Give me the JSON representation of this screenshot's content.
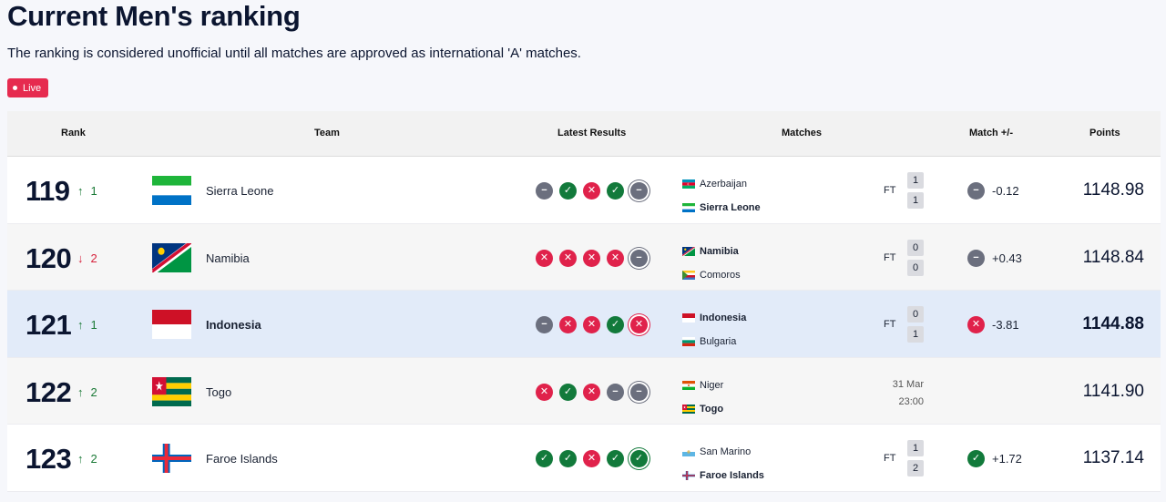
{
  "page": {
    "title": "Current Men's ranking",
    "subtitle": "The ranking is considered unofficial until all matches are approved as international 'A' matches.",
    "live_label": "Live"
  },
  "columns": {
    "rank": "Rank",
    "team": "Team",
    "latest_results": "Latest Results",
    "matches": "Matches",
    "match_pm": "Match +/-",
    "points": "Points"
  },
  "rows": [
    {
      "rank": "119",
      "move_dir": "up",
      "move": "1",
      "team": "Sierra Leone",
      "flag": "sierra-leone",
      "results": [
        "draw",
        "win",
        "loss",
        "win",
        "draw"
      ],
      "home": "Azerbaijan",
      "home_flag": "azerbaijan",
      "away": "Sierra Leone",
      "away_flag": "sierra-leone",
      "status": "FT",
      "home_score": "1",
      "away_score": "1",
      "pm_result": "draw",
      "pm": "-0.12",
      "points": "1148.98"
    },
    {
      "rank": "120",
      "move_dir": "down",
      "move": "2",
      "team": "Namibia",
      "flag": "namibia",
      "results": [
        "loss",
        "loss",
        "loss",
        "loss",
        "draw"
      ],
      "home": "Namibia",
      "home_flag": "namibia",
      "away": "Comoros",
      "away_flag": "comoros",
      "status": "FT",
      "home_score": "0",
      "away_score": "0",
      "pm_result": "draw",
      "pm": "+0.43",
      "points": "1148.84"
    },
    {
      "rank": "121",
      "move_dir": "up",
      "move": "1",
      "team": "Indonesia",
      "flag": "indonesia",
      "results": [
        "draw",
        "loss",
        "loss",
        "win",
        "loss"
      ],
      "home": "Indonesia",
      "home_flag": "indonesia",
      "away": "Bulgaria",
      "away_flag": "bulgaria",
      "status": "FT",
      "home_score": "0",
      "away_score": "1",
      "pm_result": "loss",
      "pm": "-3.81",
      "points": "1144.88"
    },
    {
      "rank": "122",
      "move_dir": "up",
      "move": "2",
      "team": "Togo",
      "flag": "togo",
      "results": [
        "loss",
        "win",
        "loss",
        "draw",
        "draw"
      ],
      "home": "Niger",
      "home_flag": "niger",
      "away": "Togo",
      "away_flag": "togo",
      "date": "31 Mar",
      "time": "23:00",
      "points": "1141.90"
    },
    {
      "rank": "123",
      "move_dir": "up",
      "move": "2",
      "team": "Faroe Islands",
      "flag": "faroe-islands",
      "results": [
        "win",
        "win",
        "loss",
        "win",
        "win"
      ],
      "home": "San Marino",
      "home_flag": "san-marino",
      "away": "Faroe Islands",
      "away_flag": "faroe-islands",
      "status": "FT",
      "home_score": "1",
      "away_score": "2",
      "pm_result": "win",
      "pm": "+1.72",
      "points": "1137.14"
    }
  ],
  "colors": {
    "win": "#127a3b",
    "loss": "#e0224b",
    "draw": "#6b6f7e",
    "live": "#e62b4f",
    "highlight_row": "#e2ebf9"
  }
}
